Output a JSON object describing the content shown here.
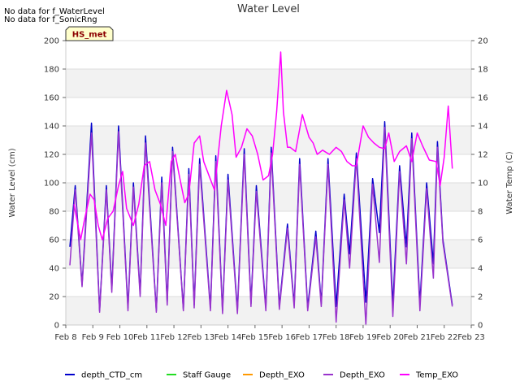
{
  "notes": [
    "No data for f_WaterLevel",
    "No data for f_SonicRng"
  ],
  "badge": "HS_met",
  "chart_data": {
    "type": "line",
    "title": "Water Level",
    "xlabel": "",
    "ylabel": "Water Level (cm)",
    "y2label": "Water Temp (C)",
    "ylim": [
      0,
      200
    ],
    "y2lim": [
      0,
      20
    ],
    "yticks": [
      0,
      20,
      40,
      60,
      80,
      100,
      120,
      140,
      160,
      180,
      200
    ],
    "y2ticks": [
      0,
      2,
      4,
      6,
      8,
      10,
      12,
      14,
      16,
      18,
      20
    ],
    "xlim": [
      8,
      23
    ],
    "xticks": [
      8,
      9,
      10,
      11,
      12,
      13,
      14,
      15,
      16,
      17,
      18,
      19,
      20,
      21,
      22,
      23
    ],
    "xtick_labels": [
      "Feb 8",
      "Feb 9",
      "Feb 10",
      "Feb 11",
      "Feb 12",
      "Feb 13",
      "Feb 14",
      "Feb 15",
      "Feb 16",
      "Feb 17",
      "Feb 18",
      "Feb 19",
      "Feb 20",
      "Feb 21",
      "Feb 22",
      "Feb 23"
    ],
    "grid": "horizontal bands",
    "legend": "bottom",
    "series": [
      {
        "name": "depth_CTD_cm",
        "axis": "left",
        "color": "#0000cc",
        "peaks": [
          [
            8.35,
            98
          ],
          [
            8.95,
            142
          ],
          [
            9.5,
            98
          ],
          [
            9.95,
            140
          ],
          [
            10.5,
            100
          ],
          [
            10.95,
            133
          ],
          [
            11.55,
            104
          ],
          [
            11.95,
            125
          ],
          [
            12.55,
            110
          ],
          [
            12.95,
            117
          ],
          [
            13.55,
            119
          ],
          [
            14.0,
            106
          ],
          [
            14.6,
            124
          ],
          [
            15.05,
            98
          ],
          [
            15.6,
            125
          ],
          [
            16.2,
            71
          ],
          [
            16.65,
            117
          ],
          [
            17.25,
            66
          ],
          [
            17.7,
            117
          ],
          [
            18.3,
            92
          ],
          [
            18.75,
            121
          ],
          [
            19.35,
            103
          ],
          [
            19.8,
            143
          ],
          [
            20.35,
            112
          ],
          [
            20.8,
            135
          ],
          [
            21.35,
            100
          ],
          [
            21.75,
            129
          ]
        ],
        "troughs": [
          [
            8.15,
            55
          ],
          [
            8.6,
            28
          ],
          [
            9.25,
            10
          ],
          [
            9.7,
            25
          ],
          [
            10.3,
            12
          ],
          [
            10.75,
            22
          ],
          [
            11.35,
            10
          ],
          [
            11.75,
            16
          ],
          [
            12.35,
            11
          ],
          [
            12.75,
            14
          ],
          [
            13.35,
            12
          ],
          [
            13.8,
            10
          ],
          [
            14.35,
            10
          ],
          [
            14.85,
            15
          ],
          [
            15.4,
            12
          ],
          [
            15.9,
            13
          ],
          [
            16.45,
            14
          ],
          [
            16.95,
            12
          ],
          [
            17.45,
            15
          ],
          [
            18.0,
            13
          ],
          [
            18.5,
            50
          ],
          [
            19.1,
            16
          ],
          [
            19.6,
            65
          ],
          [
            20.1,
            14
          ],
          [
            20.6,
            55
          ],
          [
            21.1,
            15
          ],
          [
            21.6,
            43
          ],
          [
            21.95,
            60
          ],
          [
            22.3,
            14
          ]
        ]
      },
      {
        "name": "Staff Gauge",
        "axis": "left",
        "color": "#22dd22",
        "values": []
      },
      {
        "name": "Depth_EXO",
        "axis": "left",
        "color": "#ff9900",
        "values": []
      },
      {
        "name": "Depth_EXO",
        "axis": "left",
        "color": "#9933cc",
        "peaks": [
          [
            8.35,
            95
          ],
          [
            8.95,
            135
          ],
          [
            9.5,
            95
          ],
          [
            9.95,
            136
          ],
          [
            10.5,
            97
          ],
          [
            10.95,
            128
          ],
          [
            11.55,
            100
          ],
          [
            11.95,
            122
          ],
          [
            12.55,
            106
          ],
          [
            12.95,
            113
          ],
          [
            13.55,
            115
          ],
          [
            14.0,
            102
          ],
          [
            14.6,
            120
          ],
          [
            15.05,
            94
          ],
          [
            15.6,
            121
          ],
          [
            16.2,
            68
          ],
          [
            16.65,
            113
          ],
          [
            17.25,
            62
          ],
          [
            17.7,
            113
          ],
          [
            18.3,
            88
          ],
          [
            18.75,
            117
          ],
          [
            19.35,
            99
          ],
          [
            19.8,
            139
          ],
          [
            20.35,
            108
          ],
          [
            20.8,
            131
          ],
          [
            21.35,
            96
          ],
          [
            21.75,
            125
          ]
        ],
        "troughs": [
          [
            8.15,
            42
          ],
          [
            8.6,
            27
          ],
          [
            9.25,
            9
          ],
          [
            9.7,
            23
          ],
          [
            10.3,
            10
          ],
          [
            10.75,
            20
          ],
          [
            11.35,
            9
          ],
          [
            11.75,
            14
          ],
          [
            12.35,
            10
          ],
          [
            12.75,
            12
          ],
          [
            13.35,
            10
          ],
          [
            13.8,
            8
          ],
          [
            14.35,
            8
          ],
          [
            14.85,
            13
          ],
          [
            15.4,
            10
          ],
          [
            15.9,
            11
          ],
          [
            16.45,
            12
          ],
          [
            16.95,
            10
          ],
          [
            17.45,
            13
          ],
          [
            18.0,
            2
          ],
          [
            18.5,
            40
          ],
          [
            19.1,
            0
          ],
          [
            19.6,
            44
          ],
          [
            20.1,
            6
          ],
          [
            20.6,
            43
          ],
          [
            21.1,
            10
          ],
          [
            21.6,
            33
          ],
          [
            21.95,
            58
          ],
          [
            22.3,
            13
          ]
        ]
      },
      {
        "name": "Temp_EXO",
        "axis": "right",
        "color": "#ff00ff",
        "x": [
          8.3,
          8.55,
          8.7,
          8.9,
          9.05,
          9.2,
          9.35,
          9.55,
          9.75,
          9.95,
          10.1,
          10.25,
          10.5,
          10.7,
          10.9,
          11.1,
          11.3,
          11.5,
          11.7,
          11.9,
          12.05,
          12.2,
          12.4,
          12.55,
          12.75,
          12.95,
          13.1,
          13.3,
          13.5,
          13.75,
          13.95,
          14.15,
          14.3,
          14.5,
          14.7,
          14.9,
          15.1,
          15.3,
          15.5,
          15.65,
          15.8,
          15.95,
          16.05,
          16.2,
          16.3,
          16.5,
          16.75,
          17.0,
          17.15,
          17.3,
          17.5,
          17.75,
          18.0,
          18.2,
          18.4,
          18.6,
          18.75,
          19.0,
          19.2,
          19.4,
          19.6,
          19.8,
          19.95,
          20.15,
          20.35,
          20.6,
          20.8,
          21.0,
          21.2,
          21.45,
          21.7,
          21.85,
          22.0,
          22.15,
          22.3
        ],
        "y": [
          8.5,
          6.0,
          7.5,
          9.2,
          8.8,
          7.0,
          6.0,
          7.5,
          8.0,
          9.8,
          10.8,
          8.2,
          7.0,
          8.5,
          11.2,
          11.5,
          9.5,
          8.5,
          7.0,
          11.5,
          12.0,
          10.5,
          8.6,
          9.2,
          12.8,
          13.3,
          11.5,
          10.5,
          9.5,
          14.0,
          16.5,
          14.8,
          11.8,
          12.5,
          13.8,
          13.3,
          12.0,
          10.2,
          10.5,
          12.0,
          15.0,
          19.2,
          15.0,
          12.5,
          12.5,
          12.2,
          14.8,
          13.2,
          12.8,
          12.0,
          12.3,
          12.0,
          12.5,
          12.2,
          11.5,
          11.2,
          11.2,
          14.0,
          13.2,
          12.8,
          12.5,
          12.4,
          13.5,
          11.5,
          12.2,
          12.6,
          11.5,
          13.5,
          12.6,
          11.6,
          11.5,
          9.8,
          11.8,
          15.4,
          11.0
        ]
      }
    ]
  }
}
